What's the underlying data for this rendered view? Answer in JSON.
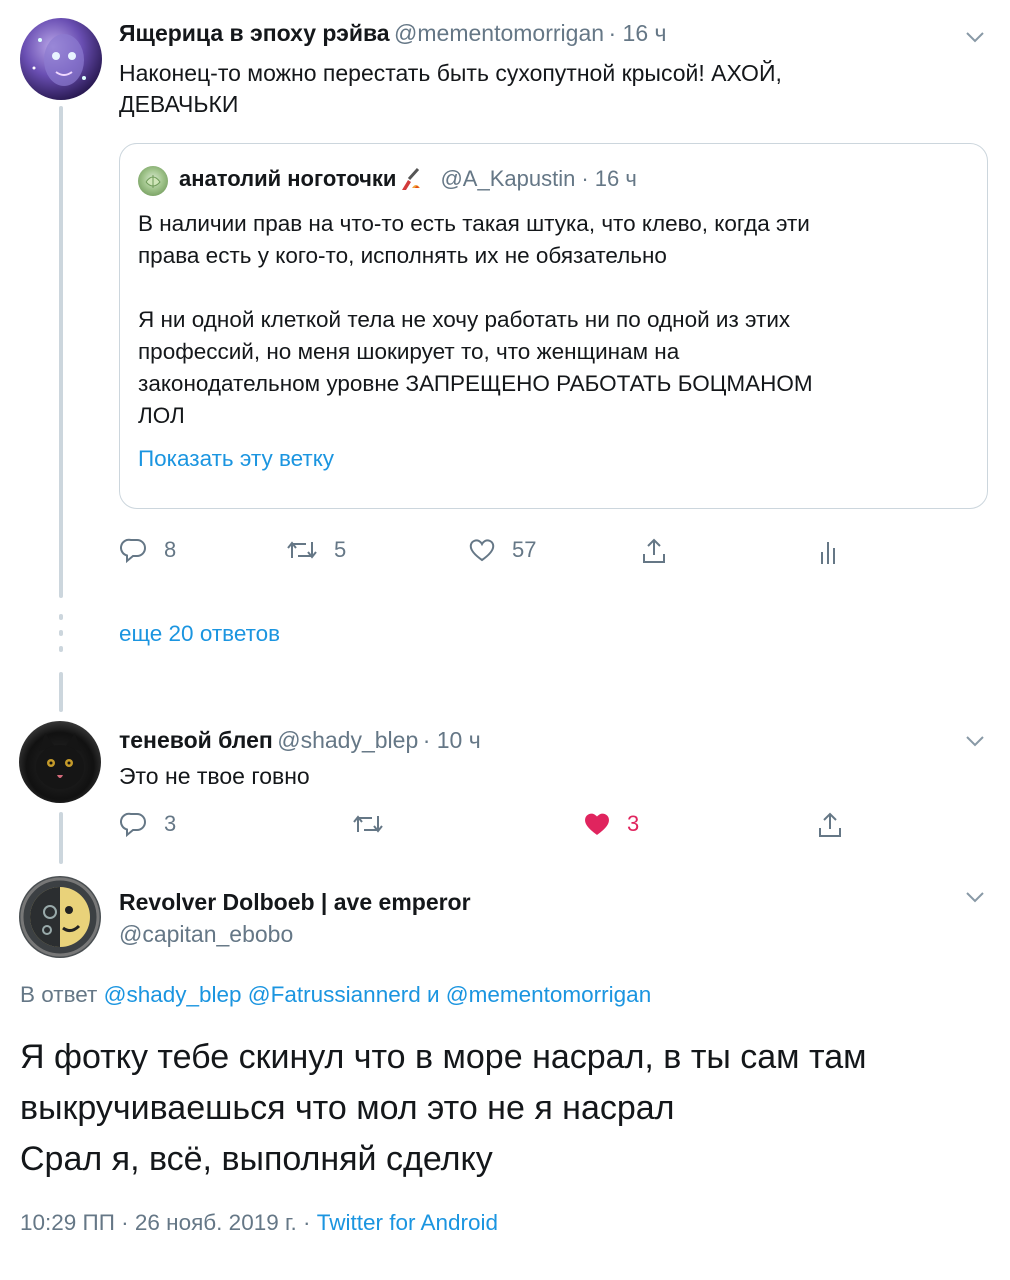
{
  "tweet1": {
    "name": "Ящерица в эпоху рэйва",
    "handle": "@mementomorrigan",
    "time": "· 16 ч",
    "text_line1": "Наконец-то можно перестать быть сухопутной крысой! АХОЙ,",
    "text_line2": "ДЕВАЧЬКИ",
    "quote": {
      "name": "анатолий ноготочки",
      "handle": "@A_Kapustin",
      "time": "· 16 ч",
      "p1_line1": "В наличии прав на что-то есть такая штука, что клево, когда эти",
      "p1_line2": "права есть у кого-то, исполнять их не обязательно",
      "p2_line1": "Я ни одной клеткой тела не хочу работать ни по одной из этих",
      "p2_line2": "профессий, но меня шокирует то, что женщинам на",
      "p2_line3": "законодательном уровне ЗАПРЕЩЕНО РАБОТАТЬ БОЦМАНОМ",
      "p2_line4": "ЛОЛ",
      "show_thread": "Показать эту ветку"
    },
    "replies": "8",
    "retweets": "5",
    "likes": "57"
  },
  "more_replies": "еще 20 ответов",
  "tweet2": {
    "name": "теневой блеп",
    "handle": "@shady_blep",
    "time": "· 10 ч",
    "text": "Это не твое говно",
    "replies": "3",
    "likes": "3"
  },
  "tweet3": {
    "name": "Revolver Dolboeb | ave emperor",
    "handle": "@capitan_ebobo",
    "reply_prefix": "В ответ",
    "reply_to": "@shady_blep @Fatrussiannerd и @mementomorrigan",
    "line1": "Я фотку тебе скинул что в море насрал, в ты сам там",
    "line2": "выкручиваешься что мол это не я насрал",
    "line3": "Срал я, всё, выполняй сделку",
    "meta": "10:29 ПП · 26 нояб. 2019 г. ·",
    "source": "Twitter for Android"
  },
  "colors": {
    "link": "#1b95e0",
    "secondary": "#657786",
    "like_active": "#e0245e",
    "thread_line": "#ccd6dd"
  },
  "icons": [
    "reply-icon",
    "retweet-icon",
    "like-icon",
    "share-icon",
    "analytics-icon",
    "chevron-down-icon",
    "dots-icon",
    "fire-emoji-icon",
    "nail-polish-emoji-icon"
  ]
}
